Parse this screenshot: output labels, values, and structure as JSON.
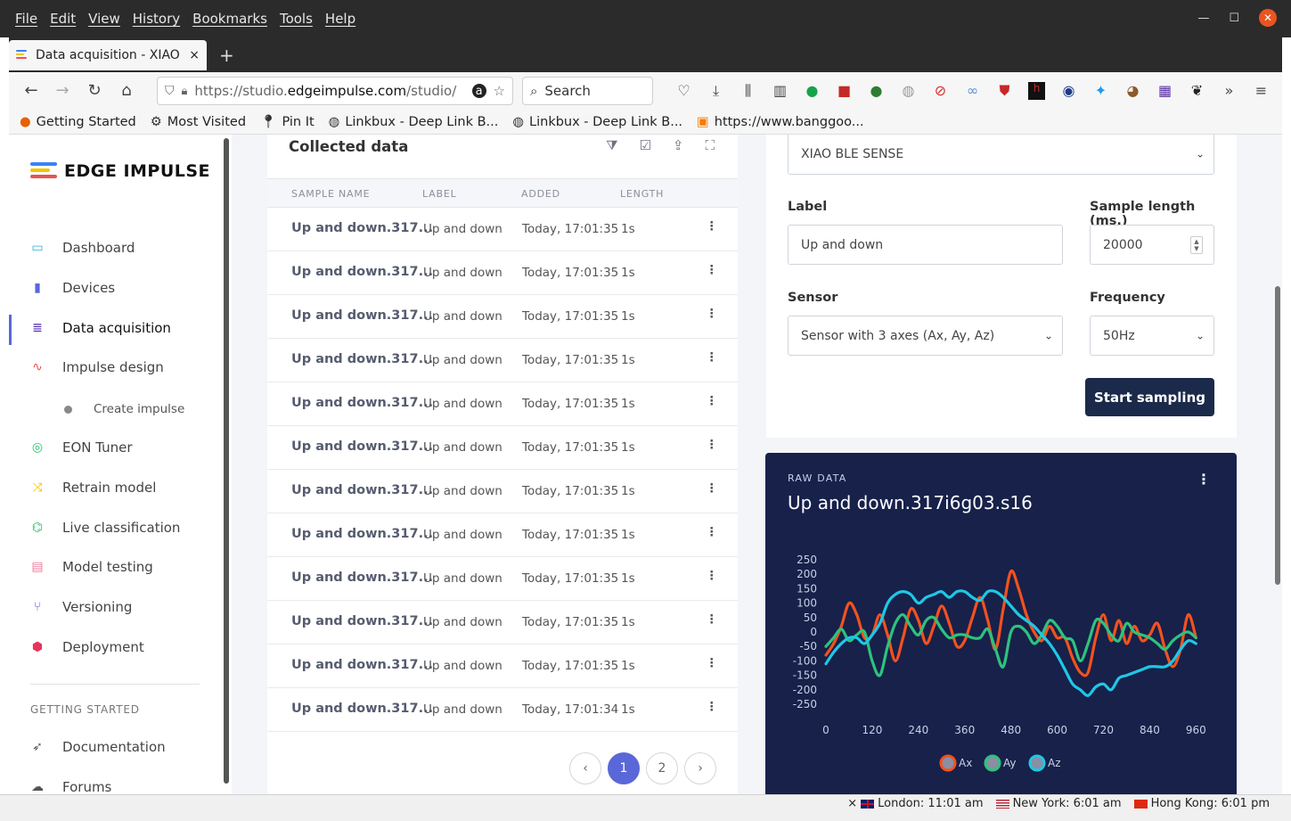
{
  "menubar": {
    "items": [
      "File",
      "Edit",
      "View",
      "History",
      "Bookmarks",
      "Tools",
      "Help"
    ]
  },
  "tab": {
    "title": "Data acquisition - XIAO BLE SENSE",
    "close": "×",
    "new": "+"
  },
  "navbar": {
    "url_prefix": "https://studio.",
    "url_domain": "edgeimpulse.com",
    "url_suffix": "/studio/",
    "search_placeholder": "Search"
  },
  "bookmarks": [
    {
      "label": "Getting Started",
      "icon": "firefox-icon"
    },
    {
      "label": "Most Visited",
      "icon": "gear-icon"
    },
    {
      "label": "Pin It",
      "icon": "pin-icon"
    },
    {
      "label": "Linkbux - Deep Link B...",
      "icon": "globe-icon"
    },
    {
      "label": "Linkbux - Deep Link B...",
      "icon": "globe-icon"
    },
    {
      "label": "https://www.banggoo...",
      "icon": "bg-icon"
    }
  ],
  "sidebar": {
    "brand": "EDGE IMPULSE",
    "items": [
      {
        "label": "Dashboard",
        "icon": "monitor-icon",
        "color": "#2bb3d6"
      },
      {
        "label": "Devices",
        "icon": "chip-icon",
        "color": "#5a67d8"
      },
      {
        "label": "Data acquisition",
        "icon": "database-icon",
        "color": "#4c2aa8"
      },
      {
        "label": "Impulse design",
        "icon": "pulse-icon",
        "color": "#e8524f"
      },
      {
        "label": "EON Tuner",
        "icon": "compass-icon",
        "color": "#2bbf6a"
      },
      {
        "label": "Retrain model",
        "icon": "shuffle-icon",
        "color": "#f2c500"
      },
      {
        "label": "Live classification",
        "icon": "network-icon",
        "color": "#2bbf6a"
      },
      {
        "label": "Model testing",
        "icon": "clipboard-icon",
        "color": "#f07a9a"
      },
      {
        "label": "Versioning",
        "icon": "branch-icon",
        "color": "#5a67d8"
      },
      {
        "label": "Deployment",
        "icon": "cube-icon",
        "color": "#e8345a"
      }
    ],
    "sub_item": "Create impulse",
    "section": "GETTING STARTED",
    "extra": [
      {
        "label": "Documentation",
        "icon": "rocket-icon"
      },
      {
        "label": "Forums",
        "icon": "chat-icon"
      }
    ]
  },
  "collected": {
    "title": "Collected data",
    "headers": [
      "SAMPLE NAME",
      "LABEL",
      "ADDED",
      "LENGTH"
    ],
    "rows": [
      {
        "name": "Up and down.317...",
        "label": "Up and down",
        "added": "Today, 17:01:35",
        "length": "1s"
      },
      {
        "name": "Up and down.317...",
        "label": "Up and down",
        "added": "Today, 17:01:35",
        "length": "1s"
      },
      {
        "name": "Up and down.317...",
        "label": "Up and down",
        "added": "Today, 17:01:35",
        "length": "1s"
      },
      {
        "name": "Up and down.317...",
        "label": "Up and down",
        "added": "Today, 17:01:35",
        "length": "1s"
      },
      {
        "name": "Up and down.317...",
        "label": "Up and down",
        "added": "Today, 17:01:35",
        "length": "1s"
      },
      {
        "name": "Up and down.317...",
        "label": "Up and down",
        "added": "Today, 17:01:35",
        "length": "1s"
      },
      {
        "name": "Up and down.317...",
        "label": "Up and down",
        "added": "Today, 17:01:35",
        "length": "1s"
      },
      {
        "name": "Up and down.317...",
        "label": "Up and down",
        "added": "Today, 17:01:35",
        "length": "1s"
      },
      {
        "name": "Up and down.317...",
        "label": "Up and down",
        "added": "Today, 17:01:35",
        "length": "1s"
      },
      {
        "name": "Up and down.317...",
        "label": "Up and down",
        "added": "Today, 17:01:35",
        "length": "1s"
      },
      {
        "name": "Up and down.317...",
        "label": "Up and down",
        "added": "Today, 17:01:35",
        "length": "1s"
      },
      {
        "name": "Up and down.317...",
        "label": "Up and down",
        "added": "Today, 17:01:34",
        "length": "1s"
      }
    ],
    "pages": [
      "‹",
      "1",
      "2",
      "›"
    ],
    "current_page": "1"
  },
  "form": {
    "device": "XIAO BLE SENSE",
    "label_title": "Label",
    "label_value": "Up and down",
    "length_title": "Sample length (ms.)",
    "length_value": "20000",
    "sensor_title": "Sensor",
    "sensor_value": "Sensor with 3 axes (Ax, Ay, Az)",
    "freq_title": "Frequency",
    "freq_value": "50Hz",
    "start": "Start sampling"
  },
  "raw": {
    "kicker": "RAW DATA",
    "title": "Up and down.317i6g03.s16"
  },
  "chart_data": {
    "type": "line",
    "yticks": [
      250,
      200,
      150,
      100,
      50,
      0,
      -50,
      -100,
      -150,
      -200,
      -250
    ],
    "xticks": [
      0,
      120,
      240,
      360,
      480,
      600,
      720,
      840,
      960
    ],
    "ylim": [
      -250,
      250
    ],
    "xlim": [
      0,
      980
    ],
    "grid": false,
    "legend": "bottom",
    "series": [
      {
        "name": "Ax",
        "color": "#f4511e",
        "x": [
          0,
          20,
          40,
          60,
          80,
          100,
          120,
          140,
          160,
          180,
          200,
          220,
          240,
          260,
          280,
          300,
          320,
          340,
          360,
          380,
          400,
          420,
          440,
          460,
          480,
          500,
          520,
          540,
          560,
          580,
          600,
          620,
          640,
          660,
          680,
          700,
          720,
          740,
          760,
          780,
          800,
          820,
          840,
          860,
          880,
          900,
          920,
          940,
          960
        ],
        "y": [
          -80,
          -40,
          20,
          100,
          60,
          -20,
          -10,
          60,
          -10,
          -100,
          -20,
          80,
          40,
          -40,
          20,
          90,
          30,
          -50,
          -30,
          50,
          120,
          40,
          -60,
          80,
          210,
          150,
          60,
          0,
          -30,
          20,
          -20,
          -20,
          -90,
          -140,
          -140,
          -20,
          60,
          -30,
          40,
          -40,
          20,
          -30,
          -10,
          30,
          -60,
          -120,
          -60,
          60,
          -20
        ]
      },
      {
        "name": "Ay",
        "color": "#2ec27e",
        "x": [
          0,
          20,
          40,
          60,
          80,
          100,
          120,
          140,
          160,
          180,
          200,
          220,
          240,
          260,
          280,
          300,
          320,
          340,
          360,
          380,
          400,
          420,
          440,
          460,
          480,
          500,
          520,
          540,
          560,
          580,
          600,
          620,
          640,
          660,
          680,
          700,
          720,
          740,
          760,
          780,
          800,
          820,
          840,
          860,
          880,
          900,
          920,
          940,
          960
        ],
        "y": [
          -50,
          -20,
          10,
          -30,
          -10,
          0,
          -100,
          -150,
          -50,
          30,
          60,
          20,
          -10,
          40,
          50,
          10,
          -20,
          -10,
          -10,
          -20,
          -20,
          10,
          -60,
          -120,
          0,
          20,
          0,
          -40,
          -10,
          40,
          20,
          -20,
          -30,
          -100,
          -40,
          40,
          30,
          -10,
          -30,
          30,
          0,
          -10,
          -20,
          -40,
          -60,
          -30,
          -10,
          0,
          -20
        ]
      },
      {
        "name": "Az",
        "color": "#1ec8e6",
        "x": [
          0,
          20,
          40,
          60,
          80,
          100,
          120,
          140,
          160,
          180,
          200,
          220,
          240,
          260,
          280,
          300,
          320,
          340,
          360,
          380,
          400,
          420,
          440,
          460,
          480,
          500,
          520,
          540,
          560,
          580,
          600,
          620,
          640,
          660,
          680,
          700,
          720,
          740,
          760,
          780,
          800,
          820,
          840,
          860,
          880,
          900,
          920,
          940,
          960
        ],
        "y": [
          -110,
          -70,
          -40,
          -20,
          -20,
          -40,
          -10,
          30,
          100,
          130,
          140,
          130,
          100,
          120,
          130,
          140,
          120,
          140,
          140,
          120,
          110,
          140,
          140,
          120,
          90,
          60,
          40,
          20,
          -10,
          -40,
          -80,
          -130,
          -180,
          -200,
          -220,
          -190,
          -180,
          -200,
          -160,
          -150,
          -140,
          -130,
          -120,
          -120,
          -120,
          -100,
          -60,
          -30,
          -40
        ]
      }
    ]
  },
  "status": {
    "clocks": [
      {
        "label": "London: 11:01 am"
      },
      {
        "label": "New York: 6:01 am"
      },
      {
        "label": "Hong Kong: 6:01 pm"
      }
    ]
  }
}
